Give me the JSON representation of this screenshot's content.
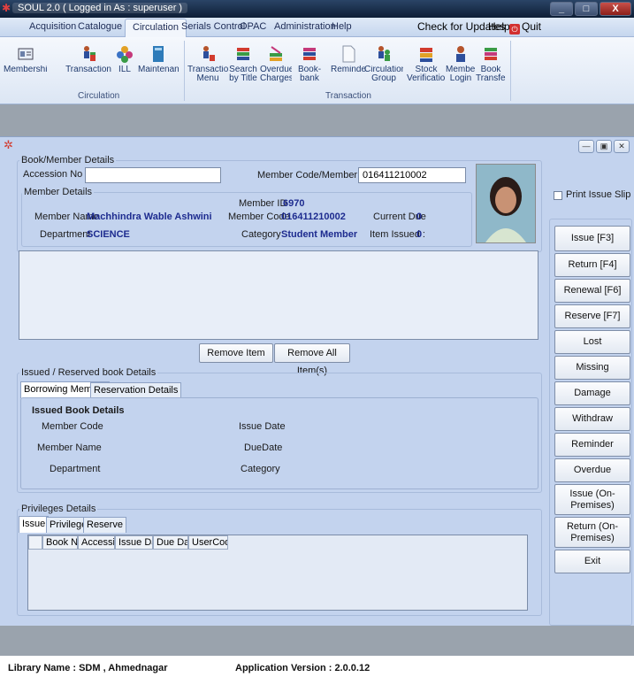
{
  "window": {
    "title": "SOUL 2.0  ( Logged in As : superuser )",
    "minimize": "_",
    "maximize": "□",
    "close": "X"
  },
  "menu": {
    "items": [
      "Acquisition",
      "Catalogue",
      "Circulation",
      "Serials Control",
      "OPAC",
      "Administration",
      "Help"
    ],
    "active": "Circulation",
    "check_updates": "Check for Updates",
    "help": "Help",
    "quit": "Quit"
  },
  "ribbon": {
    "buttons": [
      {
        "label": "Membership",
        "icon": "id-card-icon"
      },
      {
        "label": "Transaction",
        "icon": "person-books-icon"
      },
      {
        "label": "ILL",
        "icon": "colorful-flower-icon"
      },
      {
        "label": "Maintenance",
        "icon": "book-stack-icon"
      },
      {
        "label": "Transaction Menu",
        "icon": "person-books-icon"
      },
      {
        "label": "Search by Title",
        "icon": "books-search-icon"
      },
      {
        "label": "Overdue Charges",
        "icon": "books-pencil-icon"
      },
      {
        "label": "Book-bank Issue",
        "icon": "books-stack-icon"
      },
      {
        "label": "Reminder",
        "icon": "document-icon"
      },
      {
        "label": "Circulation Group",
        "icon": "group-icon"
      },
      {
        "label": "Stock Verification",
        "icon": "stock-books-icon"
      },
      {
        "label": "Member Login",
        "icon": "member-icon"
      },
      {
        "label": "Book Transfer",
        "icon": "book-transfer-icon"
      }
    ],
    "groups": [
      "Circulation",
      "Transaction"
    ]
  },
  "form": {
    "book_member_legend": "Book/Member Details",
    "accession_label": "Accession No",
    "accession_value": "",
    "member_code_label": "Member Code/Member ID",
    "member_code_value": "016411210002",
    "member_details_legend": "Member Details",
    "member_id_label": "Member ID",
    "member_id_value": "6970",
    "member_name_label": "Member Name",
    "member_name_value": "Machhindra Wable Ashwini",
    "member_code2_label": "Member Code",
    "member_code2_value": "016411210002",
    "current_due_label": "Current Due",
    "current_due_value": "0",
    "department_label": "Department",
    "department_value": "SCIENCE",
    "category_label": "Category",
    "category_value": "Student Member",
    "items_issued_label": "Item Issued :",
    "items_issued_value": "0",
    "print_issue_slip": "Print Issue Slip",
    "remove_item": "Remove Item",
    "remove_all": "Remove All Item(s)"
  },
  "issued": {
    "legend": "Issued / Reserved book Details",
    "tabs": [
      "Borrowing Member",
      "Reservation Details"
    ],
    "subheading": "Issued Book Details",
    "member_code": "Member Code",
    "issue_date": "Issue Date",
    "member_name": "Member Name",
    "due_date": "DueDate",
    "department": "Department",
    "category": "Category"
  },
  "privileges": {
    "legend": "Privileges Details",
    "tabs": [
      "Issue",
      "Privileges",
      "Reserve"
    ],
    "columns": [
      "Book Na",
      "Accessio",
      "Issue Dat",
      "Due Date",
      "UserCode"
    ]
  },
  "actions": [
    "Issue [F3]",
    "Return [F4]",
    "Renewal [F6]",
    "Reserve [F7]",
    "Lost",
    "Missing",
    "Damage",
    "Withdraw",
    "Reminder",
    "Overdue",
    "Issue (On-Premises)",
    "Return (On-Premises)",
    "Exit"
  ],
  "status": {
    "library": "Library Name : SDM , Ahmednagar",
    "version": "Application Version : 2.0.0.12"
  },
  "colors": {
    "form_bg": "#c3d3ee",
    "value_text": "#1d2b8f",
    "title_bar": "#0e1e36"
  }
}
